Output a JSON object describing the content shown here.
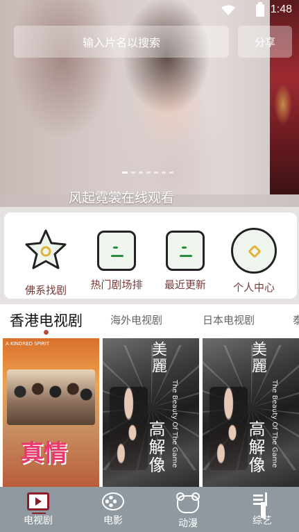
{
  "status_bar": {
    "time": "1:48"
  },
  "header": {
    "search_placeholder": "输入片名以搜索",
    "share_label": "分享"
  },
  "banner": {
    "caption": "风起霓裳在线观看",
    "slide_count": 7,
    "active_slide": 1
  },
  "quick_links": [
    {
      "label": "佛系找剧",
      "icon": "star-icon"
    },
    {
      "label": "热门剧场排",
      "icon": "list-icon"
    },
    {
      "label": "最近更新",
      "icon": "list-icon"
    },
    {
      "label": "个人中心",
      "icon": "user-circle-icon"
    }
  ],
  "category_tabs": [
    {
      "label": "香港电视剧",
      "active": true
    },
    {
      "label": "海外电视剧",
      "active": false
    },
    {
      "label": "日本电视剧",
      "active": false
    },
    {
      "label": "泰",
      "active": false
    }
  ],
  "posters": [
    {
      "title_art": "真情",
      "english": "A KINDRED SPIRIT"
    },
    {
      "title_art_top": "美麗",
      "title_art_bottom": "高解像",
      "english": "The Beauty Of The Game"
    },
    {
      "title_art_top": "美麗",
      "title_art_bottom": "高解像",
      "english": "The Beauty Of The Game"
    }
  ],
  "bottom_nav": [
    {
      "label": "电视剧",
      "icon": "tv-icon",
      "active": true
    },
    {
      "label": "电影",
      "icon": "film-reel-icon",
      "active": false
    },
    {
      "label": "动漫",
      "icon": "bear-icon",
      "active": false
    },
    {
      "label": "综艺",
      "icon": "music-list-icon",
      "active": false
    }
  ],
  "colors": {
    "accent": "#8a1f2a",
    "quick_label": "#7a3a3a",
    "bottom_nav_bg": "#8f999f",
    "tab_indicator": "#b84c3c"
  }
}
